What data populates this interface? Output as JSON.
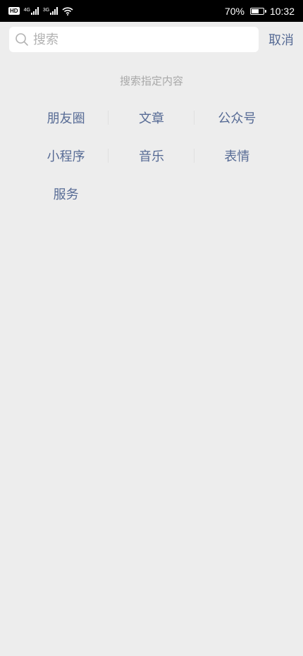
{
  "status_bar": {
    "hd": "HD",
    "net1": "4G",
    "net2": "3G",
    "battery": "70%",
    "battery_level": 0.7,
    "time": "10:32"
  },
  "search": {
    "placeholder": "搜索",
    "cancel_label": "取消",
    "hint": "搜索指定内容"
  },
  "categories": [
    {
      "label": "朋友圈"
    },
    {
      "label": "文章"
    },
    {
      "label": "公众号"
    },
    {
      "label": "小程序"
    },
    {
      "label": "音乐"
    },
    {
      "label": "表情"
    },
    {
      "label": "服务"
    }
  ],
  "colors": {
    "accent": "#576b95",
    "background": "#ededed",
    "hint": "#a8a8a8"
  }
}
